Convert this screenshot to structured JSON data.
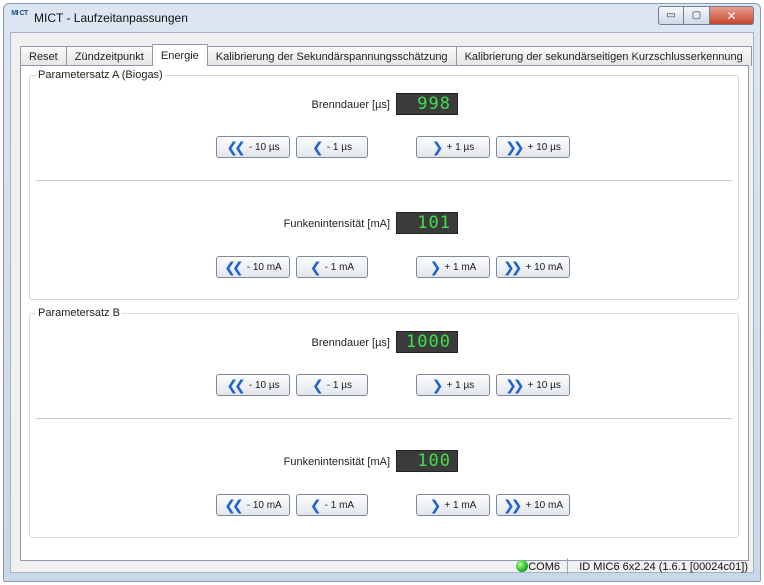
{
  "window": {
    "icon_text": "MI CT",
    "title": "MICT - Laufzeitanpassungen",
    "controls": {
      "minimize": "▭",
      "maximize": "▢",
      "close": "✕"
    }
  },
  "tabs": [
    {
      "label": "Reset"
    },
    {
      "label": "Zündzeitpunkt"
    },
    {
      "label": "Energie"
    },
    {
      "label": "Kalibrierung der Sekundärspannungsschätzung"
    },
    {
      "label": "Kalibrierung der sekundärseitigen Kurzschlusserkennung"
    }
  ],
  "active_tab": "Energie",
  "group_a": {
    "title": "Parametersatz A (Biogas)",
    "duration": {
      "label": "Brenndauer [µs]",
      "value": "998",
      "buttons": [
        "- 10 µs",
        "- 1 µs",
        "+ 1 µs",
        "+ 10 µs"
      ]
    },
    "intensity": {
      "label": "Funkenintensität [mA]",
      "value": "101",
      "buttons": [
        "- 10 mA",
        "- 1 mA",
        "+ 1 mA",
        "+ 10 mA"
      ]
    }
  },
  "group_b": {
    "title": "Parametersatz B",
    "duration": {
      "label": "Brenndauer [µs]",
      "value": "1000",
      "buttons": [
        "- 10 µs",
        "- 1 µs",
        "+ 1 µs",
        "+ 10 µs"
      ]
    },
    "intensity": {
      "label": "Funkenintensität [mA]",
      "value": "100",
      "buttons": [
        "- 10 mA",
        "- 1 mA",
        "+ 1 mA",
        "+ 10 mA"
      ]
    }
  },
  "icons": {
    "double_left": "❮❮",
    "single_left": "❮",
    "single_right": "❯",
    "double_right": "❯❯"
  },
  "status": {
    "port": "COM6",
    "device_id": "ID MIC6 6x2.24 (1.6.1 [00024c01])",
    "connection_color": "#22b422"
  },
  "colors": {
    "display_bg": "#3b3b3b",
    "display_digits": "#3ee04a",
    "button_icon": "#1f63d1"
  }
}
